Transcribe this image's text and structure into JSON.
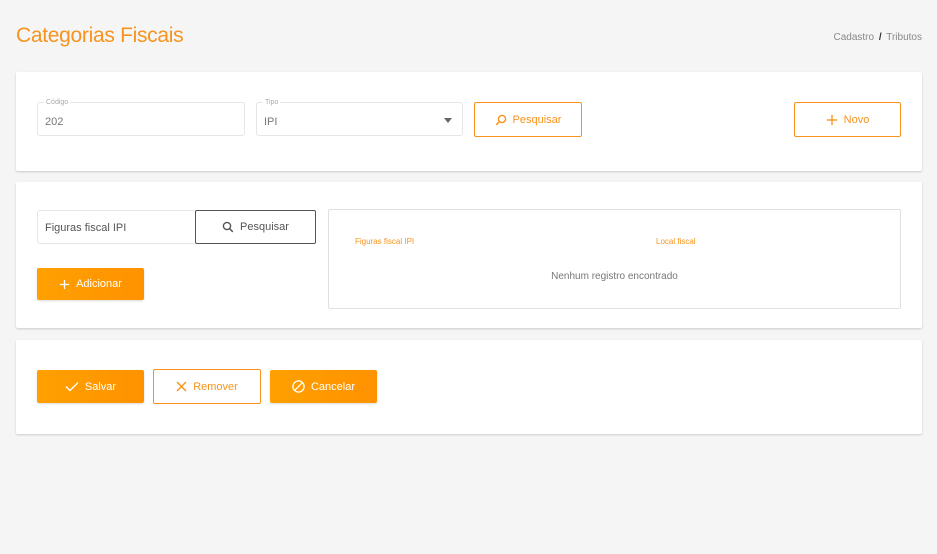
{
  "header": {
    "title": "Categorias Fiscais",
    "breadcrumb": {
      "first": "Cadastro",
      "separator": "/",
      "second": "Tributos"
    }
  },
  "filters": {
    "codigo": {
      "label": "Código",
      "value": "202"
    },
    "tipo": {
      "label": "Tipo",
      "value": "IPI"
    },
    "search_label": "Pesquisar",
    "new_label": "Novo"
  },
  "figures": {
    "input_value": "Figuras fiscal IPI",
    "search_label": "Pesquisar",
    "add_label": "Adicionar",
    "table": {
      "columns": [
        "Figuras fiscal IPI",
        "Local fiscal"
      ],
      "empty_message": "Nenhum registro encontrado"
    }
  },
  "actions": {
    "save_label": "Salvar",
    "remove_label": "Remover",
    "cancel_label": "Cancelar"
  },
  "colors": {
    "accent": "#f7931e",
    "button_fill": "#ff9800"
  },
  "icons": [
    "search-icon",
    "plus-icon",
    "check-icon",
    "close-icon",
    "cancel-icon",
    "caret-down-icon"
  ]
}
